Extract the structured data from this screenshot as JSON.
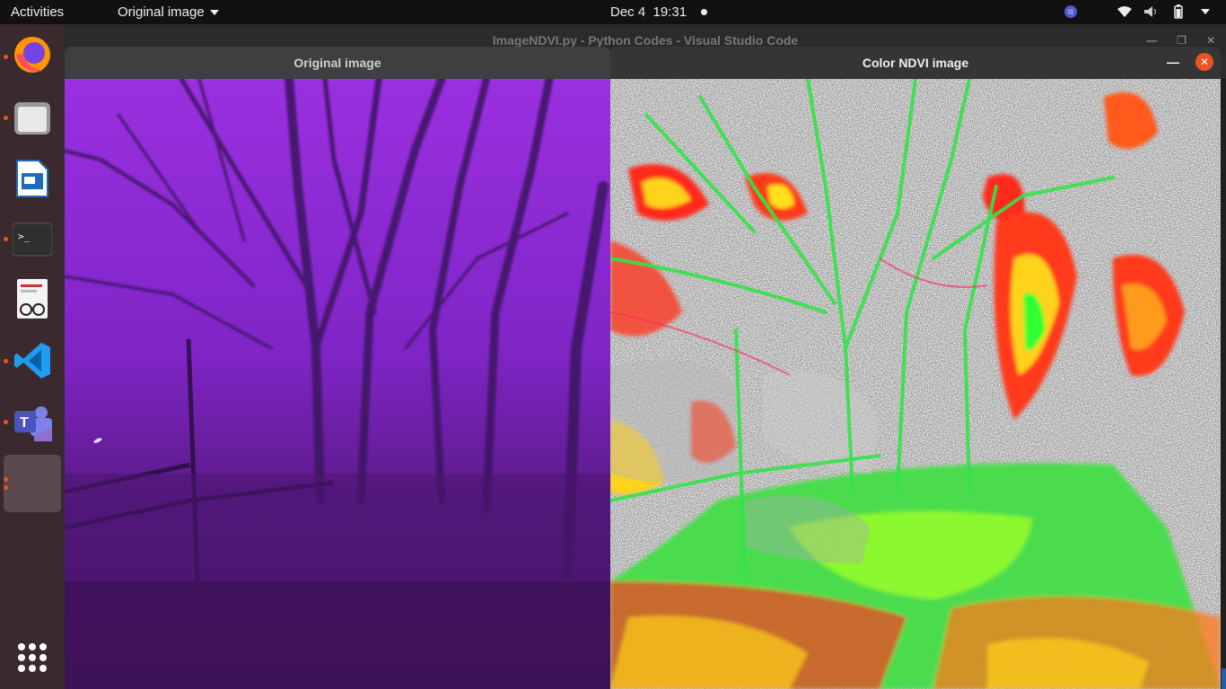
{
  "topbar": {
    "activities": "Activities",
    "app_menu": "Original image",
    "date": "Dec 4",
    "time": "19:31"
  },
  "dock": {
    "items": [
      "firefox-icon",
      "files-icon",
      "writer-icon",
      "terminal-icon",
      "document-viewer-icon",
      "vscode-icon",
      "teams-icon",
      "active-app-slot"
    ]
  },
  "background_window": {
    "title": "ImageNDVI.py - Python Codes - Visual Studio Code"
  },
  "window_original": {
    "title": "Original image"
  },
  "window_ndvi": {
    "title": "Color NDVI image",
    "minimize": "—",
    "close": "✕"
  },
  "colors": {
    "accent": "#e95420",
    "purple_bg": "#8a2ad0"
  }
}
